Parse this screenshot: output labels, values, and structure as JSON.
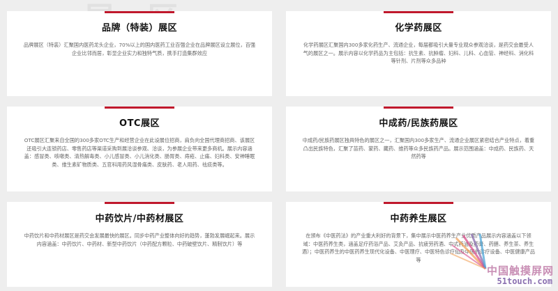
{
  "background_watermark": "展 区",
  "accent_color": "#c0182c",
  "zones": [
    {
      "title": "品牌（特装）展区",
      "description": "品牌展区（特装）汇聚国内医药龙头企业，70%以上的国内医药工业百强企业在品牌展区设立展位，百强企业比邻而居，彰显企业实力和独特气质，携手打造集群效应"
    },
    {
      "title": "化学药展区",
      "description": "化学药展区汇聚国内300多家化药生产、流通企业，每届都吸引大量专业观众参观洽谈，是药交会最受人气的展区之一。展示内容以化学药品为主包括：抗生素、抗肿瘤、妇科、儿科、心血管、神经科、消化科等针剂、片剂等众多品种"
    },
    {
      "title": "OTC展区",
      "description": "OTC展区汇聚来自全国的300多家OTC生产和经营企业在此设展位招商，肩负向全国代理商招商、该展区还吸引大连锁药店、零售药店等渠道采购到展洽谈参观、洽谈，为参展企业带来更多商机。展示内容涵盖：感冒类、咳嗽类、清热解毒类、小儿感冒类、小儿消化类、肠胃类、痔疮、止痛、妇科类、安神睡眠类、维生素矿物质类、五官科用药风湿骨痛类、皮肤药、老人用药、祛痰类等。"
    },
    {
      "title": "中成药/民族药展区",
      "description": "中成药/民族药展区独具特色的展区之一，汇聚国内300多家生产、流通企业展区紧密结合产业特点，着重凸出民族特色，汇聚了苗药、蒙药、藏药、维药等众多民族药产品。展示范围涵盖：中成药、民族药、天然药等"
    },
    {
      "title": "中药饮片/中药材展区",
      "description": "中药饮片和中药材展区是药交会发展最快的展区。同步中药产业整体向好的趋势，蓬勃发展崛起来。展示内容涵盖：中药饮片、中药材、新型中药饮片（中药配方颗粒、中药破壁饮片、精制饮片）等"
    },
    {
      "title": "中药养生展区",
      "description": "在颁布《中医药法》的产业重大利好的背景下，集中展示中医药养生产业优质产品展示内容涵盖以下领域：中医药养生类，涵盖足疗药浴产品、艾灸产品、抗疲劳药酒、中式药油及药膏、药膳、养生茶、养生酒）；中医药养生的中医药养生现代化设备、中医理疗、中医特色诊疗仙及中医的诊疗设备、中医健康产品等"
    }
  ],
  "site_watermark": {
    "cn": "中国触摸屏网",
    "en": "51touch.com",
    "colors": [
      "#f2a25c",
      "#d94f8c",
      "#8a6fb0",
      "#4fa8d9"
    ]
  }
}
